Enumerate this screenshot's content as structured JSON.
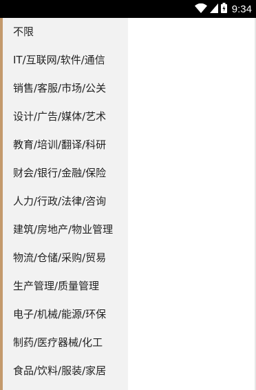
{
  "status_bar": {
    "time": "9:34",
    "icons": [
      "wifi-icon",
      "signal-icon",
      "battery-icon"
    ]
  },
  "colors": {
    "status_bar": "#000000",
    "menu_background": "#f2f2f2",
    "left_accent": "#c49a6c",
    "text": "#222222"
  },
  "categories": [
    "不限",
    "IT/互联网/软件/通信",
    "销售/客服/市场/公关",
    "设计/广告/媒体/艺术",
    "教育/培训/翻译/科研",
    "财会/银行/金融/保险",
    "人力/行政/法律/咨询",
    "建筑/房地产/物业管理",
    "物流/仓储/采购/贸易",
    "生产管理/质量管理",
    "电子/机械/能源/环保",
    "制药/医疗器械/化工",
    "食品/饮料/服装/家居"
  ]
}
